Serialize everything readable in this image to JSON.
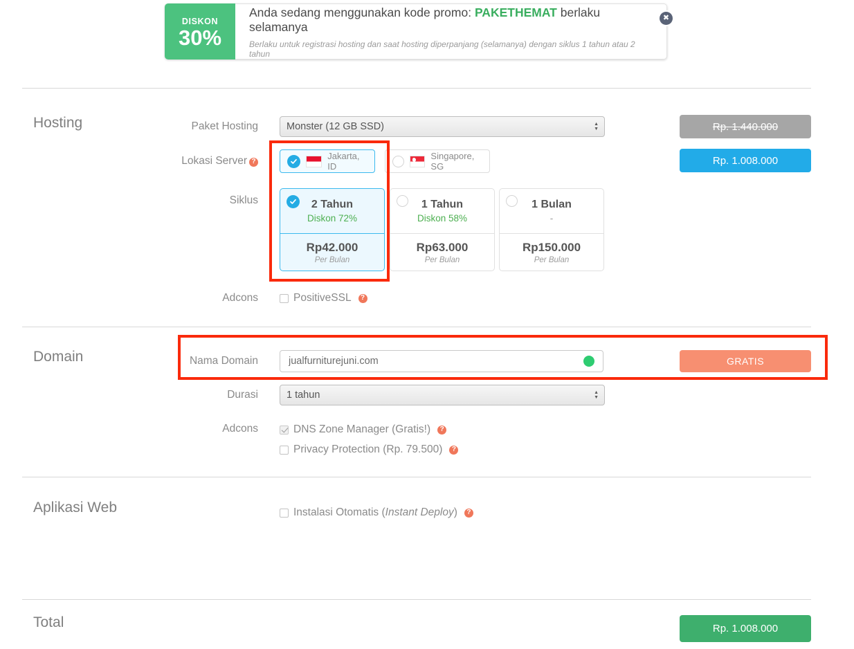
{
  "promo": {
    "badge_word": "DISKON",
    "badge_percent": "30%",
    "message_prefix": "Anda sedang menggunakan kode promo: ",
    "code": "PAKETHEMAT",
    "message_suffix": " berlaku selamanya",
    "subtext": "Berlaku untuk registrasi hosting dan saat hosting diperpanjang (selamanya) dengan siklus 1 tahun atau 2 tahun",
    "close_icon": "close-icon",
    "close_glyph": "✖",
    "accent_color": "#4cc27f",
    "code_color": "#3aae5f"
  },
  "hosting": {
    "section_title": "Hosting",
    "paket_label": "Paket Hosting",
    "paket_value": "Monster (12 GB SSD)",
    "lokasi_label": "Lokasi Server",
    "lokasi_help": "?",
    "locations": [
      {
        "name": "Jakarta, ID",
        "flag": "flag-id-icon",
        "selected": true
      },
      {
        "name": "Singapore, SG",
        "flag": "flag-sg-icon",
        "selected": false
      }
    ],
    "siklus_label": "Siklus",
    "cycles": [
      {
        "title": "2 Tahun",
        "discount": "Diskon 72%",
        "price": "Rp42.000",
        "per": "Per Bulan",
        "selected": true
      },
      {
        "title": "1 Tahun",
        "discount": "Diskon 58%",
        "price": "Rp63.000",
        "per": "Per Bulan",
        "selected": false
      },
      {
        "title": "1 Bulan",
        "discount": "-",
        "price": "Rp150.000",
        "per": "Per Bulan",
        "selected": false
      }
    ],
    "adcons_label": "Adcons",
    "adcons": [
      {
        "label": "PositiveSSL",
        "checked": false,
        "help": "?"
      }
    ],
    "price_old": "Rp. 1.440.000",
    "price_new": "Rp. 1.008.000"
  },
  "domain": {
    "section_title": "Domain",
    "nama_label": "Nama Domain",
    "nama_value": "jualfurniturejuni.com",
    "nama_placeholder": "Nama Domain",
    "status_icon": "available-dot-icon",
    "durasi_label": "Durasi",
    "durasi_value": "1 tahun",
    "adcons_label": "Adcons",
    "adcons": [
      {
        "label": "DNS Zone Manager (Gratis!)",
        "checked": true,
        "help": "?"
      },
      {
        "label": "Privacy Protection (Rp. 79.500)",
        "checked": false,
        "help": "?"
      }
    ],
    "price_label": "GRATIS"
  },
  "webapp": {
    "section_title": "Aplikasi Web",
    "items": [
      {
        "prefix": "Instalasi Otomatis (",
        "emphasis": "Instant Deploy",
        "suffix": ")",
        "checked": false,
        "help": "?"
      }
    ]
  },
  "total": {
    "section_title": "Total",
    "amount": "Rp. 1.008.000"
  },
  "annotations": {
    "box_color": "#fa2a0c",
    "boxes": [
      "hosting-options-highlight",
      "domain-row-highlight"
    ]
  }
}
